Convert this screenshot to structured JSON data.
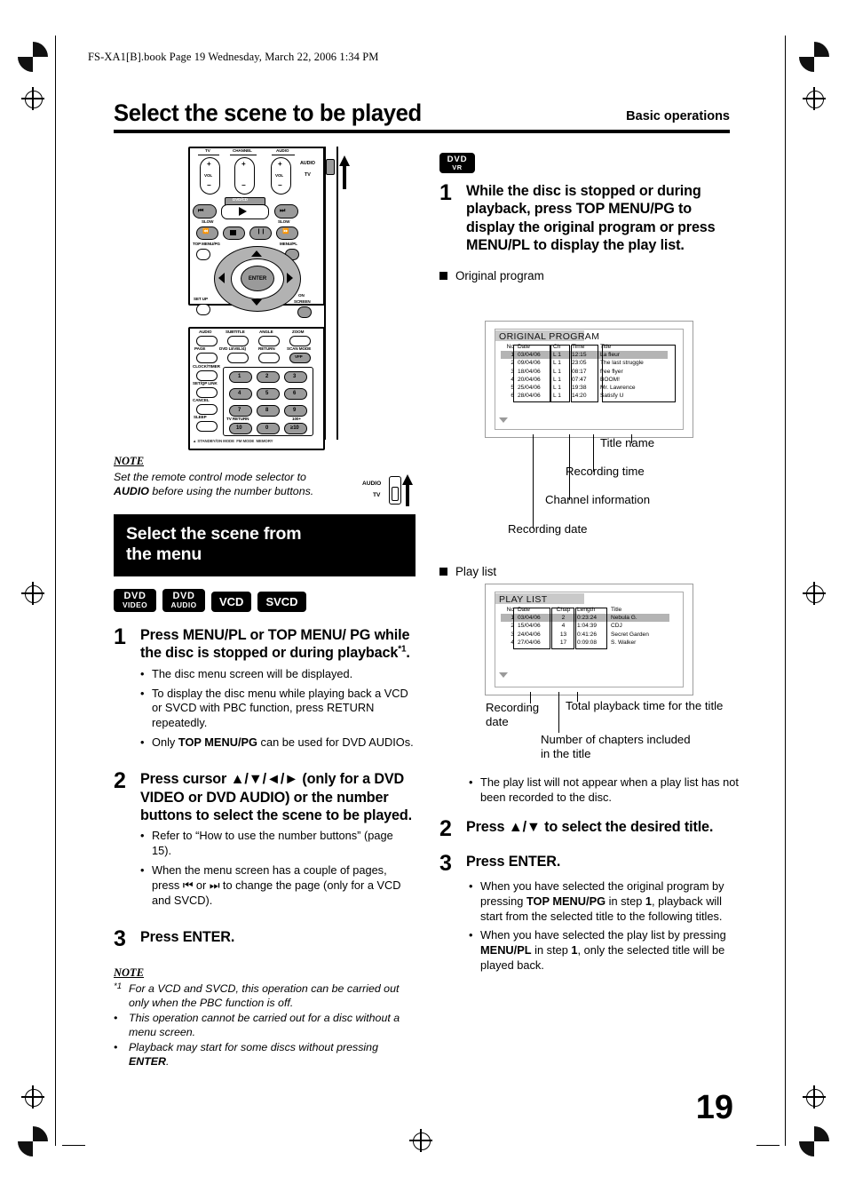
{
  "header": {
    "book_info": "FS-XA1[B].book  Page 19  Wednesday, March 22, 2006  1:34 PM",
    "page_title": "Select the scene to be played",
    "section_label": "Basic operations"
  },
  "page_number": "19",
  "remote": {
    "labels": {
      "tv": "TV",
      "channel": "CHANNEL",
      "audio": "AUDIO",
      "vol_left": "VOL",
      "vol_right": "VOL",
      "mode_audio": "AUDIO",
      "mode_tv": "TV",
      "dvdcd": "DVD/CD",
      "slow_left": "SLOW",
      "slow_right": "SLOW",
      "top_menu_pg": "TOP MENU/PG",
      "menu_pl": "MENU/PL",
      "enter": "ENTER",
      "set_up": "SET UP",
      "on_screen": "ON SCREEN",
      "audio_btn": "AUDIO",
      "subtitle": "SUBTITLE",
      "angle": "ANGLE",
      "zoom": "ZOOM",
      "page": "PAGE",
      "dvd_level": "DVD LEVEL/4)",
      "return": "RETURN",
      "scan_mode": "SCAN MODE",
      "vfp": "VFP",
      "clock_timer": "CLOCK/TIMER",
      "set_qp_link": "SET/QP LINK",
      "cancel": "CANCEL",
      "sleep": "SLEEP",
      "tv_return": "TV RETURN",
      "hundred_plus": "100+",
      "keys": [
        "1",
        "2",
        "3",
        "4",
        "5",
        "6",
        "7",
        "8",
        "9",
        "10",
        "0",
        "+10"
      ]
    }
  },
  "note_top": {
    "heading": "NOTE",
    "line1": "Set the remote control mode selector to",
    "line2_bold": "AUDIO",
    "line2_rest": " before using the number buttons.",
    "selector_audio": "AUDIO",
    "selector_tv": "TV"
  },
  "section_heading": {
    "line1": "Select the scene from",
    "line2": "the menu"
  },
  "badges_left": [
    {
      "type": "two",
      "l1": "DVD",
      "l2": "VIDEO"
    },
    {
      "type": "two",
      "l1": "DVD",
      "l2": "AUDIO"
    },
    {
      "type": "one",
      "l1": "VCD"
    },
    {
      "type": "one",
      "l1": "SVCD"
    }
  ],
  "badge_right": {
    "type": "vr",
    "l1": "DVD",
    "l2": "VR"
  },
  "left_steps": [
    {
      "num": "1",
      "text_a": "Press MENU/PL or TOP MENU/ PG while the disc is stopped or during playback",
      "text_sup": "*1",
      "text_b": ".",
      "bullets": [
        "The disc menu screen will be displayed.",
        "To display the disc menu while playing back a VCD or SVCD with PBC function, press RETURN repeatedly.",
        "Only TOP MENU/PG can be used for DVD AUDIOs."
      ]
    },
    {
      "num": "2",
      "text_a": "Press cursor ▲/▼/◄/► (only for a DVD VIDEO or DVD AUDIO) or the number buttons to select the scene to be played.",
      "bullets": [
        "Refer to “How to use the number buttons” (page 15).",
        "When the menu screen has a couple of pages, press ⏮ or ⏭ to change the page (only for a VCD and SVCD)."
      ]
    },
    {
      "num": "3",
      "text_a": "Press ENTER.",
      "bullets": []
    }
  ],
  "note_bottom": {
    "heading": "NOTE",
    "items": [
      {
        "marker": "*1",
        "text": "For a VCD and SVCD, this operation can be carried out only when the PBC function is off."
      },
      {
        "marker": "•",
        "text": "This operation cannot be carried out for a disc without a menu screen."
      },
      {
        "marker": "•",
        "text": "Playback may start for some discs without pressing ENTER."
      }
    ]
  },
  "right_steps": [
    {
      "num": "1",
      "text_a": "While the disc is stopped or during playback, press TOP MENU/PG to display the original program or press MENU/PL to display the play list."
    },
    {
      "num": "2",
      "text_a": "Press ▲/▼ to select the desired title."
    },
    {
      "num": "3",
      "text_a": "Press ENTER."
    }
  ],
  "subsections": {
    "original_program": "Original program",
    "play_list": "Play list"
  },
  "original_program_screen": {
    "title": "ORIGINAL PROGRAM",
    "columns": [
      "No",
      "Date",
      "Ch",
      "Time",
      "Title"
    ],
    "rows": [
      {
        "no": "1",
        "date": "03/04/06",
        "ch": "L  1",
        "time": "12:15",
        "title": "La fleur",
        "selected": true
      },
      {
        "no": "2",
        "date": "09/04/06",
        "ch": "L  1",
        "time": "23:05",
        "title": "The last struggle",
        "selected": false
      },
      {
        "no": "3",
        "date": "18/04/06",
        "ch": "L  1",
        "time": "08:17",
        "title": "free flyer",
        "selected": false
      },
      {
        "no": "4",
        "date": "20/04/06",
        "ch": "L  1",
        "time": "07:47",
        "title": "BOOM!",
        "selected": false
      },
      {
        "no": "5",
        "date": "25/04/06",
        "ch": "L  1",
        "time": "19:38",
        "title": "Mr. Lawrence",
        "selected": false
      },
      {
        "no": "6",
        "date": "28/04/06",
        "ch": "L  1",
        "time": "14:20",
        "title": "Satisfy U",
        "selected": false
      }
    ],
    "callouts": {
      "title_name": "Title name",
      "recording_time": "Recording time",
      "channel_information": "Channel information",
      "recording_date": "Recording date"
    }
  },
  "play_list_screen": {
    "title": "PLAY LIST",
    "columns": [
      "No",
      "Date",
      "Chap",
      "Length",
      "Title"
    ],
    "rows": [
      {
        "no": "1",
        "date": "03/04/06",
        "chap": "2",
        "length": "0:23:24",
        "title": "Nebula G.",
        "selected": true
      },
      {
        "no": "2",
        "date": "15/04/06",
        "chap": "4",
        "length": "1:04:39",
        "title": "CDJ",
        "selected": false
      },
      {
        "no": "3",
        "date": "24/04/06",
        "chap": "13",
        "length": "0:41:26",
        "title": "Secret Garden",
        "selected": false
      },
      {
        "no": "4",
        "date": "27/04/06",
        "chap": "17",
        "length": "0:09:08",
        "title": "S. Walker",
        "selected": false
      }
    ],
    "callouts": {
      "recording_date": "Recording date",
      "total_playback": "Total playback time for the title",
      "num_chapters": "Number of chapters included in the title"
    }
  },
  "right_bullets_after_playlist": [
    "The play list will not appear when a play list has not been recorded to the disc."
  ],
  "right_bullets_after_enter": [
    "When you have selected the original program by pressing TOP MENU/PG in step 1, playback will start from the selected title to the following titles.",
    "When you have selected the play list by pressing MENU/PL in step 1, only the selected title will be played back."
  ]
}
